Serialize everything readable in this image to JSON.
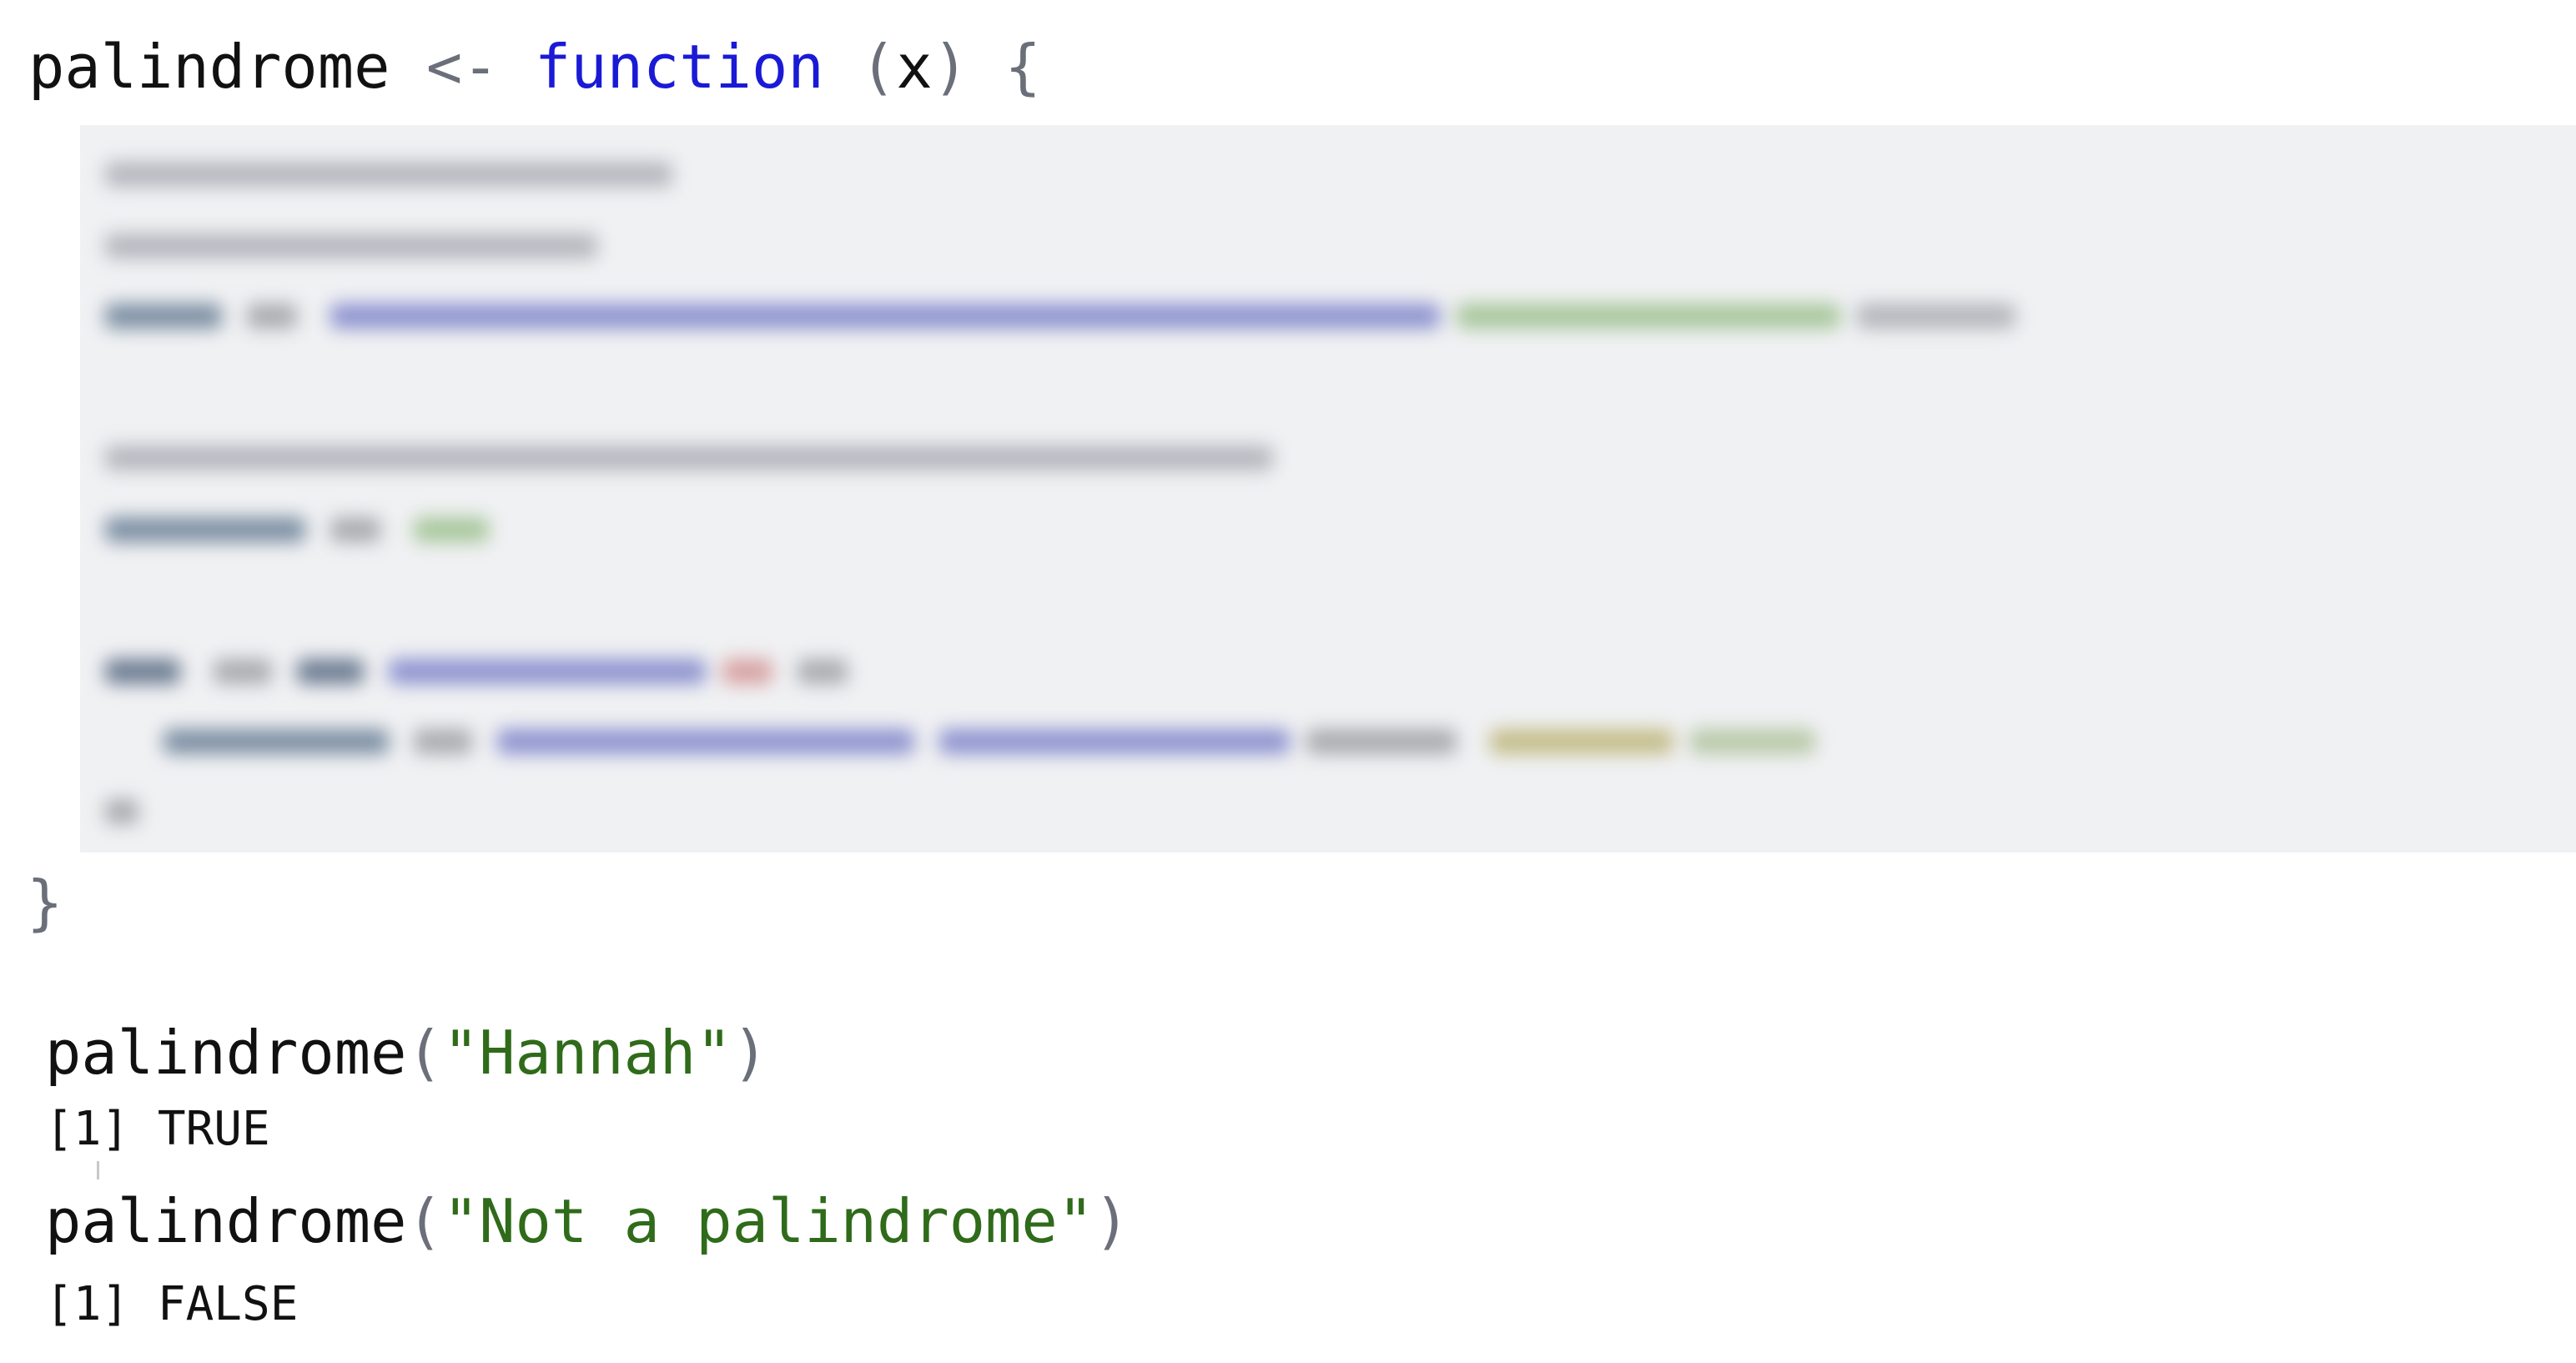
{
  "function_def": {
    "name": "palindrome",
    "assign_op": "<-",
    "keyword": "function",
    "open_paren": "(",
    "param": "x",
    "close_paren": ")",
    "open_brace": "{",
    "close_brace": "}"
  },
  "code_block": {
    "state": "blurred"
  },
  "examples": [
    {
      "fn": "palindrome",
      "open": "(",
      "arg": "\"Hannah\"",
      "close": ")",
      "output": "[1] TRUE"
    },
    {
      "fn": "palindrome",
      "open": "(",
      "arg": "\"Not a palindrome\"",
      "close": ")",
      "output": "[1] FALSE"
    }
  ],
  "colors": {
    "keyword": "#1a1ad6",
    "string": "#2f6b1a",
    "operator": "#6a6f7a",
    "code_block_bg": "#f0f1f3"
  }
}
